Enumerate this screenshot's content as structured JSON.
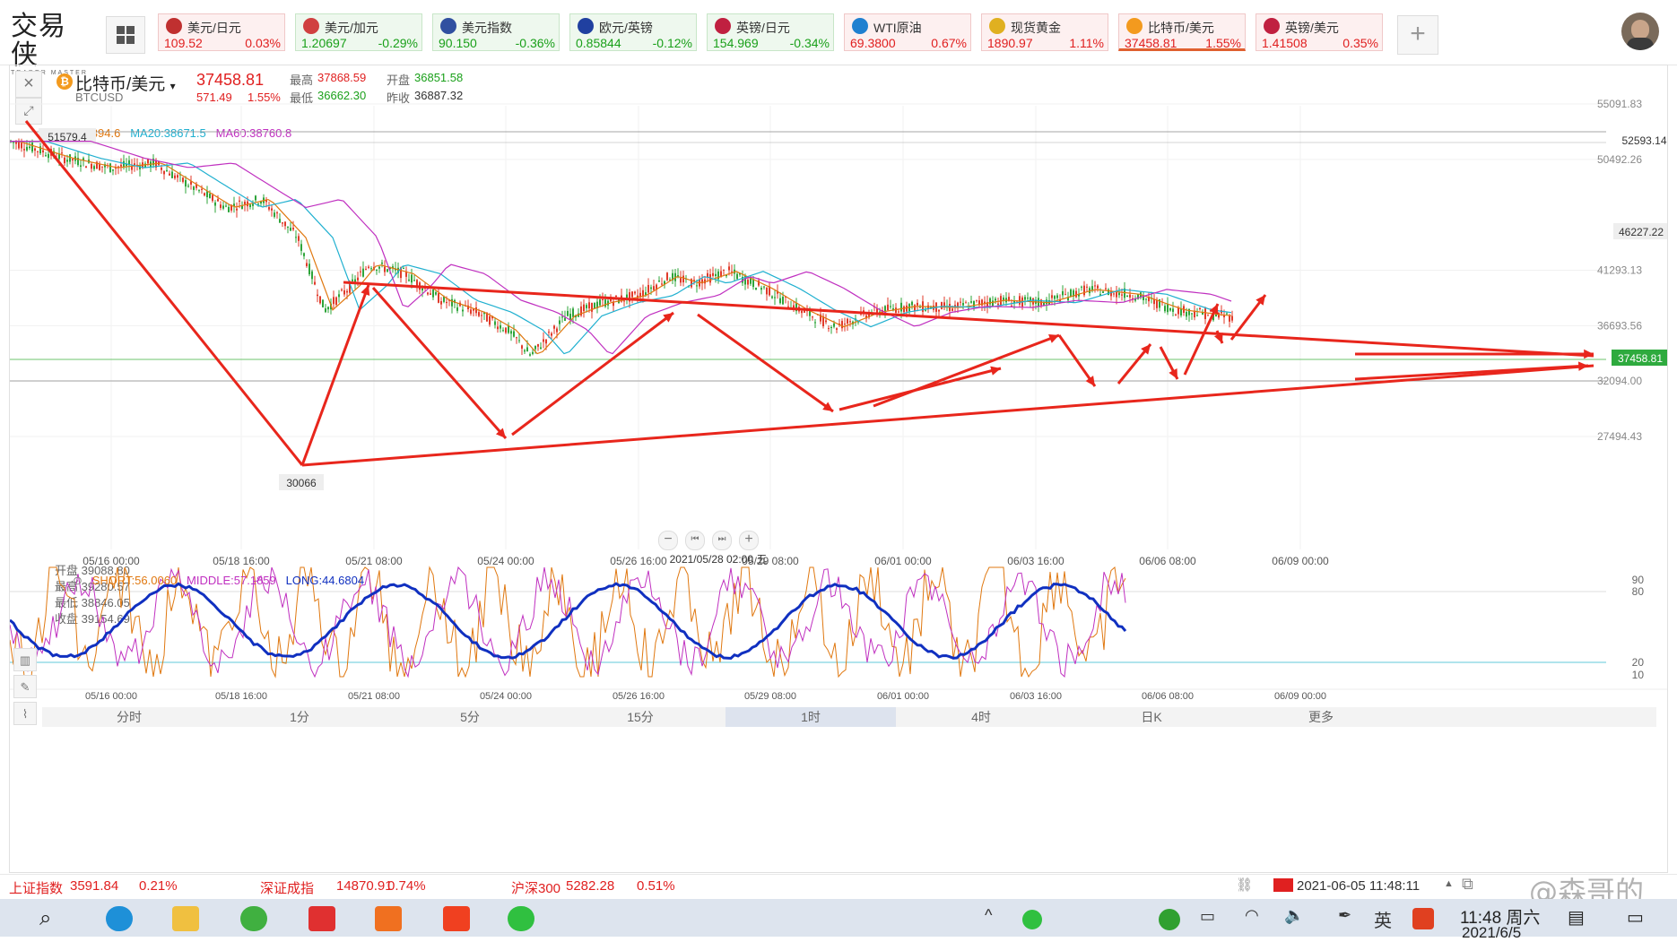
{
  "app": {
    "logo_cn": "交易侠",
    "logo_en": "TRADER MASTER"
  },
  "tickers": [
    {
      "name": "美元/日元",
      "price": "109.52",
      "change": "0.03%",
      "dir": "up"
    },
    {
      "name": "美元/加元",
      "price": "1.20697",
      "change": "-0.29%",
      "dir": "dn"
    },
    {
      "name": "美元指数",
      "price": "90.150",
      "change": "-0.36%",
      "dir": "dn"
    },
    {
      "name": "欧元/英镑",
      "price": "0.85844",
      "change": "-0.12%",
      "dir": "dn"
    },
    {
      "name": "英镑/日元",
      "price": "154.969",
      "change": "-0.34%",
      "dir": "dn"
    },
    {
      "name": "WTI原油",
      "price": "69.3800",
      "change": "0.67%",
      "dir": "up"
    },
    {
      "name": "现货黄金",
      "price": "1890.97",
      "change": "1.11%",
      "dir": "up"
    },
    {
      "name": "比特币/美元",
      "price": "37458.81",
      "change": "1.55%",
      "dir": "up"
    },
    {
      "name": "英镑/美元",
      "price": "1.41508",
      "change": "0.35%",
      "dir": "up"
    }
  ],
  "symbol": {
    "name": "比特币/美元",
    "code": "BTCUSD",
    "price": "37458.81",
    "change": "571.49",
    "change_pct": "1.55%",
    "high_label": "最高",
    "high": "37868.59",
    "open_label": "开盘",
    "open": "36851.58",
    "low_label": "最低",
    "low": "36662.30",
    "prev_label": "昨收",
    "prev": "36887.32"
  },
  "ma": {
    "ma5": "MA5:39394.6",
    "ma20": "MA20:38671.5",
    "ma60": "MA60:38760.8"
  },
  "hover_ohlc": {
    "open": "开盘 39088.80",
    "high": "最高 39280.57",
    "low": "最低 38846.05",
    "close": "收盘 39154.69"
  },
  "annotations": {
    "high_label": "51579.4",
    "low_label": "30066",
    "alert1": "52593.14",
    "alert2": "46227.22",
    "current": "37458.81",
    "crosshair_time": "2021/05/28 02:00 五"
  },
  "y_axis": [
    "55091.83",
    "50492.26",
    "41293.13",
    "36693.56",
    "32094.00",
    "27494.43"
  ],
  "x_axis": [
    "05/16 00:00",
    "05/18 16:00",
    "05/21 08:00",
    "05/24 00:00",
    "05/26 16:00",
    "05/29 08:00",
    "06/01 00:00",
    "06/03 16:00",
    "06/06 08:00",
    "06/09 00:00"
  ],
  "osc": {
    "short": "SHORT:56.0060",
    "middle": "MIDDLE:57.1859",
    "long": "LONG:44.6804",
    "levels": [
      "90",
      "80",
      "20",
      "10"
    ]
  },
  "timeframes": [
    "分时",
    "1分",
    "5分",
    "15分",
    "1时",
    "4时",
    "日K",
    "更多"
  ],
  "active_timeframe": "1时",
  "footer": {
    "idx1_name": "上证指数",
    "idx1_val": "3591.84",
    "idx1_pct": "0.21%",
    "idx2_name": "深证成指",
    "idx2_val": "14870.91",
    "idx2_pct": "0.74%",
    "idx3_name": "沪深300",
    "idx3_val": "5282.28",
    "idx3_pct": "0.51%",
    "datetime": "2021-06-05 11:48:11",
    "watermark": "@森哥的"
  },
  "taskbar": {
    "time": "11:48 周六",
    "date": "2021/6/5",
    "ime": "英"
  }
}
